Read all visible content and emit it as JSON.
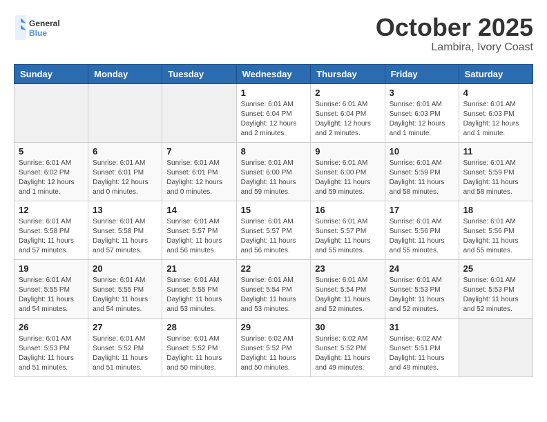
{
  "header": {
    "logo_text_general": "General",
    "logo_text_blue": "Blue",
    "month": "October 2025",
    "location": "Lambira, Ivory Coast"
  },
  "weekdays": [
    "Sunday",
    "Monday",
    "Tuesday",
    "Wednesday",
    "Thursday",
    "Friday",
    "Saturday"
  ],
  "weeks": [
    [
      {
        "day": "",
        "info": ""
      },
      {
        "day": "",
        "info": ""
      },
      {
        "day": "",
        "info": ""
      },
      {
        "day": "1",
        "info": "Sunrise: 6:01 AM\nSunset: 6:04 PM\nDaylight: 12 hours and 2 minutes."
      },
      {
        "day": "2",
        "info": "Sunrise: 6:01 AM\nSunset: 6:04 PM\nDaylight: 12 hours and 2 minutes."
      },
      {
        "day": "3",
        "info": "Sunrise: 6:01 AM\nSunset: 6:03 PM\nDaylight: 12 hours and 1 minute."
      },
      {
        "day": "4",
        "info": "Sunrise: 6:01 AM\nSunset: 6:03 PM\nDaylight: 12 hours and 1 minute."
      }
    ],
    [
      {
        "day": "5",
        "info": "Sunrise: 6:01 AM\nSunset: 6:02 PM\nDaylight: 12 hours and 1 minute."
      },
      {
        "day": "6",
        "info": "Sunrise: 6:01 AM\nSunset: 6:01 PM\nDaylight: 12 hours and 0 minutes."
      },
      {
        "day": "7",
        "info": "Sunrise: 6:01 AM\nSunset: 6:01 PM\nDaylight: 12 hours and 0 minutes."
      },
      {
        "day": "8",
        "info": "Sunrise: 6:01 AM\nSunset: 6:00 PM\nDaylight: 11 hours and 59 minutes."
      },
      {
        "day": "9",
        "info": "Sunrise: 6:01 AM\nSunset: 6:00 PM\nDaylight: 11 hours and 59 minutes."
      },
      {
        "day": "10",
        "info": "Sunrise: 6:01 AM\nSunset: 5:59 PM\nDaylight: 11 hours and 58 minutes."
      },
      {
        "day": "11",
        "info": "Sunrise: 6:01 AM\nSunset: 5:59 PM\nDaylight: 11 hours and 58 minutes."
      }
    ],
    [
      {
        "day": "12",
        "info": "Sunrise: 6:01 AM\nSunset: 5:58 PM\nDaylight: 11 hours and 57 minutes."
      },
      {
        "day": "13",
        "info": "Sunrise: 6:01 AM\nSunset: 5:58 PM\nDaylight: 11 hours and 57 minutes."
      },
      {
        "day": "14",
        "info": "Sunrise: 6:01 AM\nSunset: 5:57 PM\nDaylight: 11 hours and 56 minutes."
      },
      {
        "day": "15",
        "info": "Sunrise: 6:01 AM\nSunset: 5:57 PM\nDaylight: 11 hours and 56 minutes."
      },
      {
        "day": "16",
        "info": "Sunrise: 6:01 AM\nSunset: 5:57 PM\nDaylight: 11 hours and 55 minutes."
      },
      {
        "day": "17",
        "info": "Sunrise: 6:01 AM\nSunset: 5:56 PM\nDaylight: 11 hours and 55 minutes."
      },
      {
        "day": "18",
        "info": "Sunrise: 6:01 AM\nSunset: 5:56 PM\nDaylight: 11 hours and 55 minutes."
      }
    ],
    [
      {
        "day": "19",
        "info": "Sunrise: 6:01 AM\nSunset: 5:55 PM\nDaylight: 11 hours and 54 minutes."
      },
      {
        "day": "20",
        "info": "Sunrise: 6:01 AM\nSunset: 5:55 PM\nDaylight: 11 hours and 54 minutes."
      },
      {
        "day": "21",
        "info": "Sunrise: 6:01 AM\nSunset: 5:55 PM\nDaylight: 11 hours and 53 minutes."
      },
      {
        "day": "22",
        "info": "Sunrise: 6:01 AM\nSunset: 5:54 PM\nDaylight: 11 hours and 53 minutes."
      },
      {
        "day": "23",
        "info": "Sunrise: 6:01 AM\nSunset: 5:54 PM\nDaylight: 11 hours and 52 minutes."
      },
      {
        "day": "24",
        "info": "Sunrise: 6:01 AM\nSunset: 5:53 PM\nDaylight: 11 hours and 52 minutes."
      },
      {
        "day": "25",
        "info": "Sunrise: 6:01 AM\nSunset: 5:53 PM\nDaylight: 11 hours and 52 minutes."
      }
    ],
    [
      {
        "day": "26",
        "info": "Sunrise: 6:01 AM\nSunset: 5:53 PM\nDaylight: 11 hours and 51 minutes."
      },
      {
        "day": "27",
        "info": "Sunrise: 6:01 AM\nSunset: 5:52 PM\nDaylight: 11 hours and 51 minutes."
      },
      {
        "day": "28",
        "info": "Sunrise: 6:01 AM\nSunset: 5:52 PM\nDaylight: 11 hours and 50 minutes."
      },
      {
        "day": "29",
        "info": "Sunrise: 6:02 AM\nSunset: 5:52 PM\nDaylight: 11 hours and 50 minutes."
      },
      {
        "day": "30",
        "info": "Sunrise: 6:02 AM\nSunset: 5:52 PM\nDaylight: 11 hours and 49 minutes."
      },
      {
        "day": "31",
        "info": "Sunrise: 6:02 AM\nSunset: 5:51 PM\nDaylight: 11 hours and 49 minutes."
      },
      {
        "day": "",
        "info": ""
      }
    ]
  ]
}
